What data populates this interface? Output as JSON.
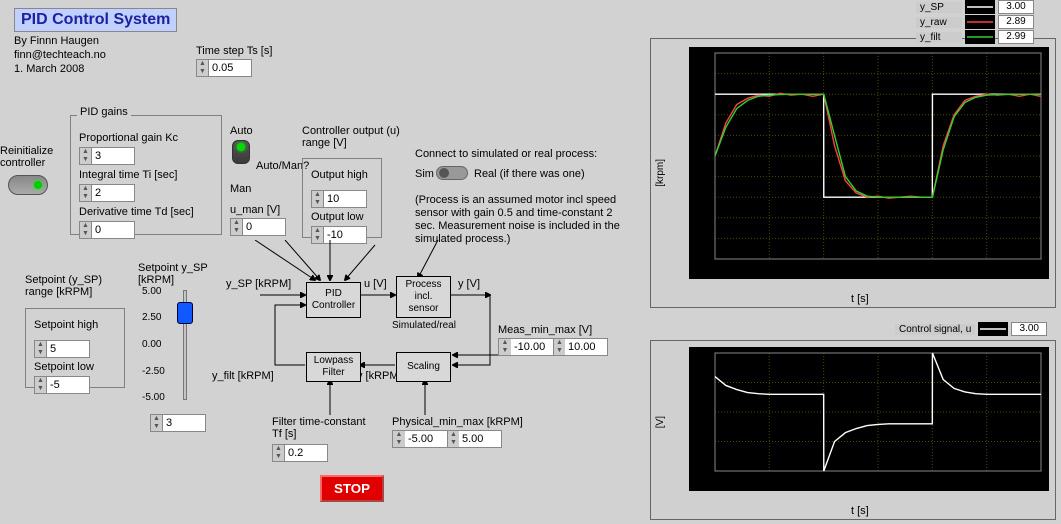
{
  "title": "PID Control System",
  "author": "By Finnn Haugen",
  "email": "finn@techteach.no",
  "date": "1. March 2008",
  "time_step_label": "Time step Ts [s]",
  "time_step_value": "0.05",
  "reinit_label": "Reinitialize\ncontroller",
  "pid_gains_title": "PID gains",
  "gain_kc_label": "Proportional gain Kc",
  "gain_kc_value": "3",
  "gain_ti_label": "Integral time Ti [sec]",
  "gain_ti_value": "2",
  "gain_td_label": "Derivative time Td [sec]",
  "gain_td_value": "0",
  "auto_label": "Auto",
  "automan_label": "Auto/Man?",
  "man_label": "Man",
  "u_man_label": "u_man [V]",
  "u_man_value": "0",
  "ctrl_out_title": "Controller output (u)\nrange [V]",
  "out_high_label": "Output high",
  "out_high_value": "10",
  "out_low_label": "Output low",
  "out_low_value": "-10",
  "connect_label": "Connect to simulated or real process:",
  "sim_label": "Sim",
  "real_label": "Real (if there was one)",
  "process_note": "(Process is an assumed motor incl speed sensor with gain 0.5 and time-constant 2 sec. Measurement noise is included in the simulated process.)",
  "sp_range_title": "Setpoint (y_SP)\nrange [kRPM]",
  "sp_high_label": "Setpoint high",
  "sp_high_value": "5",
  "sp_low_label": "Setpoint low",
  "sp_low_value": "-5",
  "slider_label": "Setpoint y_SP\n[kRPM]",
  "slider_value": "3",
  "slider_ticks": [
    "5.00",
    "2.50",
    "0.00",
    "-2.50",
    "-5.00"
  ],
  "sig_y_sp": "y_SP [kRPM]",
  "sig_u": "u [V]",
  "sig_y": "y [V]",
  "sig_y_filt": "y_filt [kRPM]",
  "sig_y_krpm": "y [kRPM]",
  "box_pid": "PID\nController",
  "box_proc1": "Process\nincl.\nsensor",
  "box_proc2": "Simulated/real",
  "box_lp": "Lowpass\nFilter",
  "box_sc": "Scaling",
  "meas_label": "Meas_min_max [V]",
  "meas_min": "-10.00",
  "meas_max": "10.00",
  "phys_label": "Physical_min_max [kRPM]",
  "phys_min": "-5.00",
  "phys_max": "5.00",
  "filter_label": "Filter time-constant\nTf [s]",
  "filter_value": "0.2",
  "stop_label": "STOP",
  "legend": {
    "y_sp": {
      "name": "y_SP",
      "color": "#ffffff",
      "value": "3.00"
    },
    "y_raw": {
      "name": "y_raw",
      "color": "#ff4040",
      "value": "2.89"
    },
    "y_filt": {
      "name": "y_filt",
      "color": "#30d030",
      "value": "2.99"
    }
  },
  "legend2": {
    "name": "Control signal, u",
    "color": "#ffffff",
    "value": "3.00"
  },
  "chart_data": [
    {
      "type": "line",
      "title": "",
      "xlabel": "t [s]",
      "ylabel": "[krpm]",
      "xlim": [
        0,
        30
      ],
      "ylim": [
        -5,
        5
      ],
      "x": [
        0,
        1,
        2,
        3,
        4,
        5,
        6,
        7,
        8,
        9,
        10,
        10.01,
        11,
        12,
        13,
        14,
        15,
        16,
        17,
        18,
        19,
        20,
        20.01,
        21,
        22,
        23,
        24,
        25,
        26,
        27,
        28,
        29,
        30
      ],
      "series": [
        {
          "name": "y_SP",
          "color": "#ffffff",
          "values": [
            3,
            3,
            3,
            3,
            3,
            3,
            3,
            3,
            3,
            3,
            3,
            -2,
            -2,
            -2,
            -2,
            -2,
            -2,
            -2,
            -2,
            -2,
            -2,
            -2,
            3,
            3,
            3,
            3,
            3,
            3,
            3,
            3,
            3,
            3,
            3
          ]
        },
        {
          "name": "y_raw",
          "color": "#ff4040",
          "values": [
            0,
            1.6,
            2.5,
            2.8,
            2.95,
            2.9,
            3.05,
            2.95,
            3.0,
            2.9,
            3.0,
            3.0,
            0.5,
            -1.2,
            -1.8,
            -2.0,
            -1.95,
            -2.05,
            -2.0,
            -1.95,
            -2.0,
            -2.0,
            -2.0,
            0.5,
            2.0,
            2.7,
            2.9,
            3.0,
            2.95,
            3.0,
            2.9,
            3.0,
            2.89
          ]
        },
        {
          "name": "y_filt",
          "color": "#30d030",
          "values": [
            0,
            1.4,
            2.3,
            2.7,
            2.9,
            2.95,
            2.98,
            3.0,
            3.0,
            3.0,
            3.0,
            3.0,
            1.0,
            -1.0,
            -1.7,
            -1.95,
            -2.0,
            -2.0,
            -2.0,
            -2.0,
            -2.0,
            -2.0,
            -2.0,
            0.3,
            1.9,
            2.6,
            2.85,
            2.95,
            2.98,
            2.99,
            3.0,
            3.0,
            2.99
          ]
        }
      ]
    },
    {
      "type": "line",
      "title": "",
      "xlabel": "t [s]",
      "ylabel": "[V]",
      "xlim": [
        0,
        30
      ],
      "ylim": [
        -10,
        10
      ],
      "x": [
        0,
        1,
        2,
        3,
        4,
        5,
        6,
        7,
        8,
        9,
        10,
        10.01,
        11,
        12,
        13,
        14,
        15,
        16,
        17,
        18,
        19,
        20,
        20.01,
        21,
        22,
        23,
        24,
        25,
        26,
        27,
        28,
        29,
        30
      ],
      "series": [
        {
          "name": "Control signal, u",
          "color": "#ffffff",
          "values": [
            6,
            4.5,
            3.8,
            3.3,
            3.1,
            3.0,
            3.0,
            3.0,
            3.0,
            3.0,
            3.0,
            -10,
            -5,
            -3.5,
            -2.8,
            -2.3,
            -2.1,
            -2.0,
            -2.0,
            -2.0,
            -2.0,
            -2.0,
            10,
            5.5,
            4.0,
            3.4,
            3.1,
            3.0,
            3.0,
            3.0,
            3.0,
            3.0,
            3.0
          ]
        }
      ]
    }
  ]
}
